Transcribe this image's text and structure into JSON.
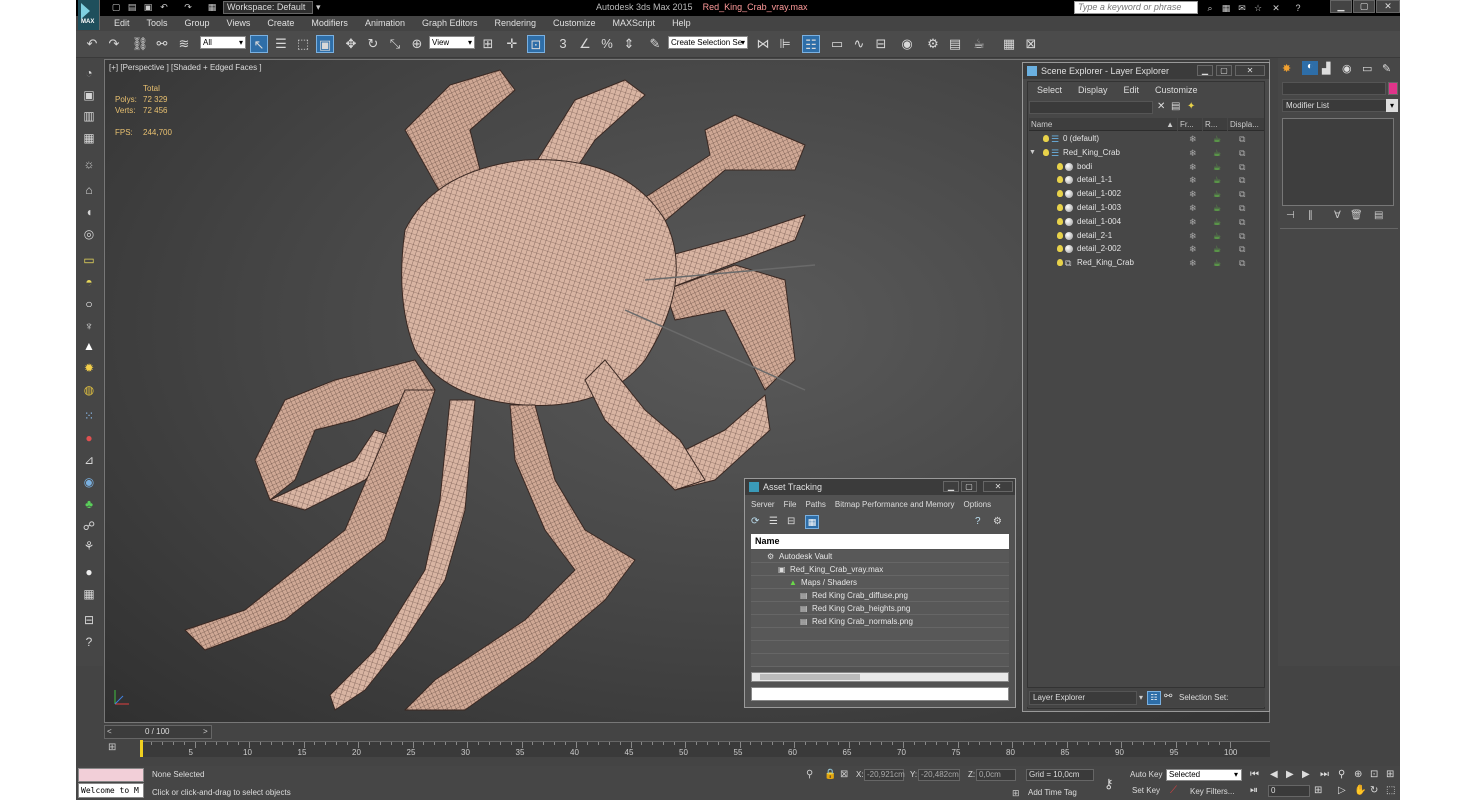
{
  "app": {
    "title_prefix": "Autodesk 3ds Max 2015",
    "file_name": "Red_King_Crab_vray.max",
    "logo_text": "MAX",
    "workspace": "Workspace: Default",
    "search_placeholder": "Type a keyword or phrase"
  },
  "menu": [
    "Edit",
    "Tools",
    "Group",
    "Views",
    "Create",
    "Modifiers",
    "Animation",
    "Graph Editors",
    "Rendering",
    "Customize",
    "MAXScript",
    "Help"
  ],
  "toolbar": {
    "filter": "All",
    "ref_coord": "View",
    "selection_set": "Create Selection Se"
  },
  "viewport": {
    "label": "[+] [Perspective ] [Shaded + Edged Faces ]",
    "stats_header": "Total",
    "polys_label": "Polys:",
    "polys_value": "72 329",
    "verts_label": "Verts:",
    "verts_value": "72 456",
    "fps_label": "FPS:",
    "fps_value": "244,700"
  },
  "scene_explorer": {
    "title": "Scene Explorer - Layer Explorer",
    "menus": [
      "Select",
      "Display",
      "Edit",
      "Customize"
    ],
    "col_name": "Name",
    "col_freeze": "Fr...",
    "col_render": "R...",
    "col_display": "Displa...",
    "rows": [
      {
        "name": "0 (default)",
        "kind": "layer",
        "indent": 0
      },
      {
        "name": "Red_King_Crab",
        "kind": "layer",
        "indent": 0
      },
      {
        "name": "bodi",
        "kind": "object",
        "indent": 1
      },
      {
        "name": "detail_1-1",
        "kind": "object",
        "indent": 1
      },
      {
        "name": "detail_1-002",
        "kind": "object",
        "indent": 1
      },
      {
        "name": "detail_1-003",
        "kind": "object",
        "indent": 1
      },
      {
        "name": "detail_1-004",
        "kind": "object",
        "indent": 1
      },
      {
        "name": "detail_2-1",
        "kind": "object",
        "indent": 1
      },
      {
        "name": "detail_2-002",
        "kind": "object",
        "indent": 1
      },
      {
        "name": "Red_King_Crab",
        "kind": "group",
        "indent": 1
      }
    ],
    "footer_left": "Layer Explorer",
    "footer_right": "Selection Set:"
  },
  "command_panel": {
    "modifier_list": "Modifier List"
  },
  "asset_tracking": {
    "title": "Asset Tracking",
    "menus": [
      "Server",
      "File",
      "Paths",
      "Bitmap Performance and Memory",
      "Options"
    ],
    "col_name": "Name",
    "rows": [
      {
        "name": "Autodesk Vault",
        "indent": 0
      },
      {
        "name": "Red_King_Crab_vray.max",
        "indent": 1
      },
      {
        "name": "Maps / Shaders",
        "indent": 2
      },
      {
        "name": "Red King Crab_diffuse.png",
        "indent": 3
      },
      {
        "name": "Red King Crab_heights.png",
        "indent": 3
      },
      {
        "name": "Red King Crab_normals.png",
        "indent": 3
      }
    ]
  },
  "timeline": {
    "frame_counter": "0 / 100",
    "ticks": [
      "0",
      "5",
      "10",
      "15",
      "20",
      "25",
      "30",
      "35",
      "40",
      "45",
      "50",
      "55",
      "60",
      "65",
      "70",
      "75",
      "80",
      "85",
      "90",
      "95",
      "100"
    ]
  },
  "status": {
    "selection": "None Selected",
    "prompt": "Click or click-and-drag to select objects",
    "maxscript_listener": "Welcome to M",
    "x_label": "X:",
    "x_value": "-20,921cm",
    "y_label": "Y:",
    "y_value": "-20,482cm",
    "z_label": "Z:",
    "z_value": "0,0cm",
    "grid": "Grid = 10,0cm",
    "add_time_tag": "Add Time Tag",
    "auto_key": "Auto Key",
    "set_key": "Set Key",
    "key_mode": "Selected",
    "key_filters": "Key Filters...",
    "frame_field": "0"
  }
}
